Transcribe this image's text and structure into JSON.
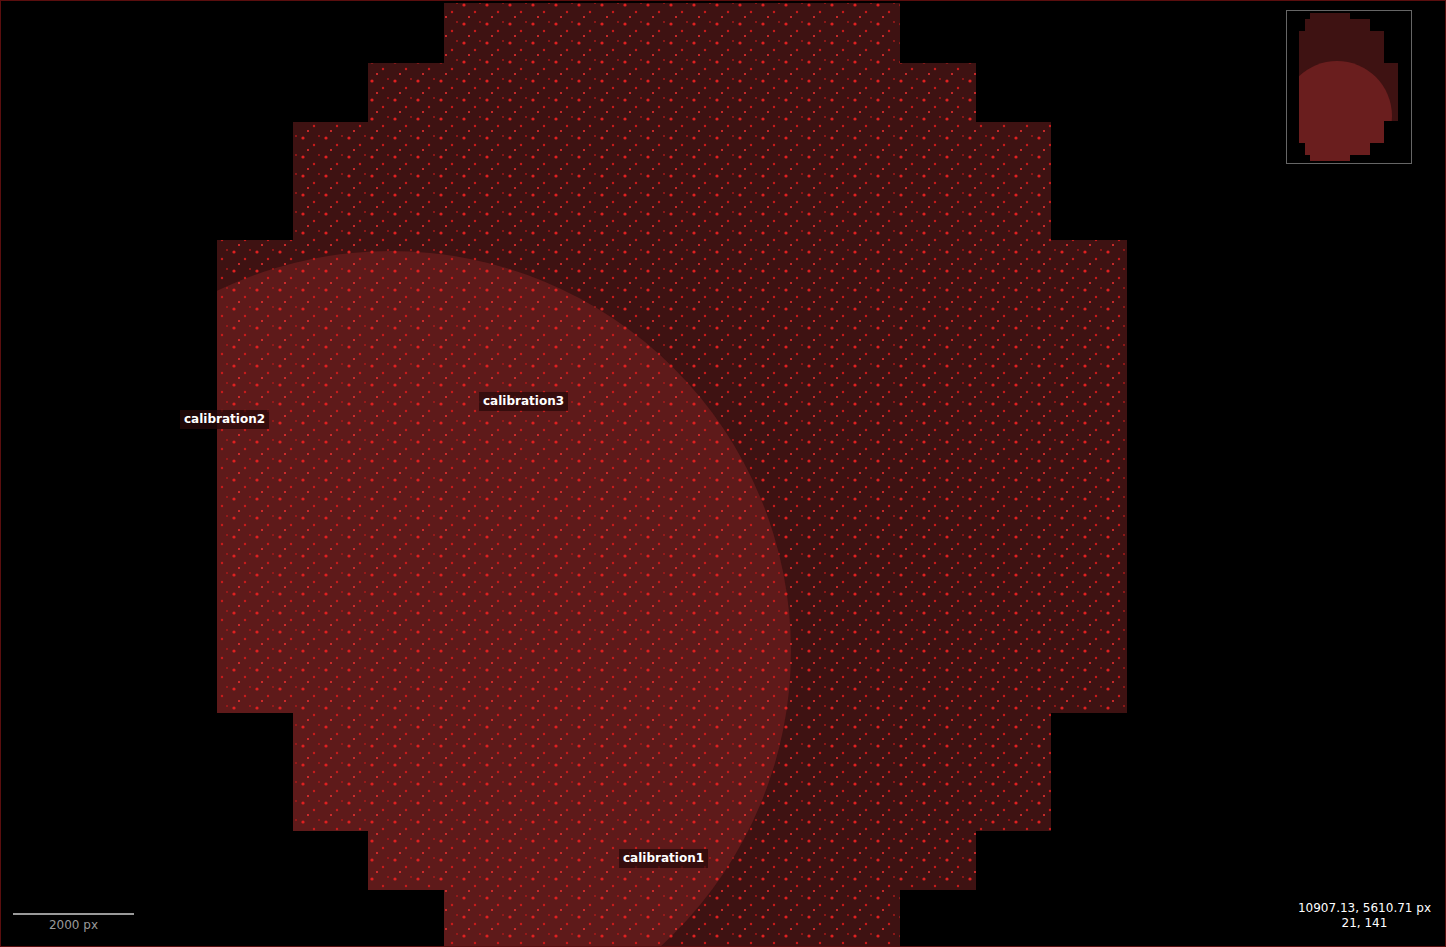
{
  "viewer": {
    "annotations": [
      {
        "text": "calibration2"
      },
      {
        "text": "calibration3"
      },
      {
        "text": "calibration1"
      }
    ]
  },
  "scale_bar": {
    "label": "2000 px"
  },
  "cursor_readout": {
    "coordinates": "10907.13, 5610.71 px",
    "value": "21, 141"
  }
}
